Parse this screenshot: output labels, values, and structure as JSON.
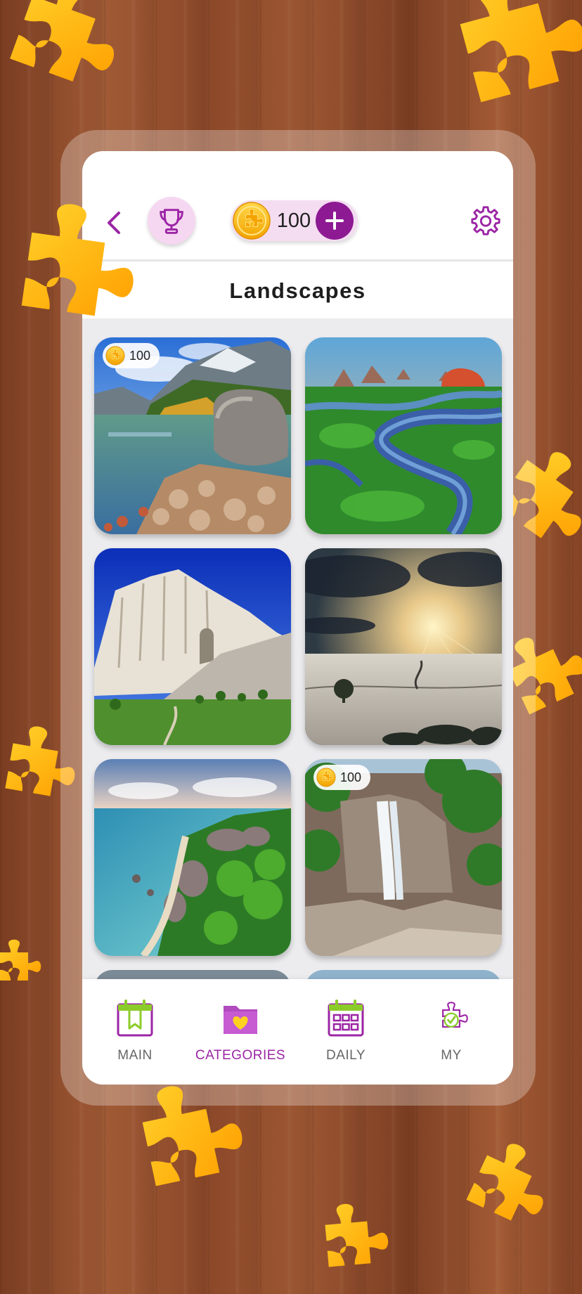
{
  "header": {
    "back_icon": "chevron-left-icon",
    "trophy_icon": "trophy-icon",
    "coins": "100",
    "add_coins_icon": "plus-icon",
    "settings_icon": "gear-icon"
  },
  "page_title": "Landscapes",
  "puzzles": [
    {
      "scene": "mountain lake with boulder",
      "price": "100"
    },
    {
      "scene": "river delta with mangroves",
      "price": null
    },
    {
      "scene": "white cliff under blue sky",
      "price": null
    },
    {
      "scene": "sunset over snowy field",
      "price": null
    },
    {
      "scene": "tropical beach with granite rocks",
      "price": null
    },
    {
      "scene": "waterfall in rainforest",
      "price": "100"
    }
  ],
  "nav": {
    "main": "MAIN",
    "categories": "CATEGORIES",
    "daily": "DAILY",
    "my": "MY",
    "active": "categories"
  },
  "colors": {
    "accent": "#9b25a5",
    "puzzle_piece": "#ffc107",
    "screen_bg": "#ffffff",
    "wood": "#8b4829"
  }
}
